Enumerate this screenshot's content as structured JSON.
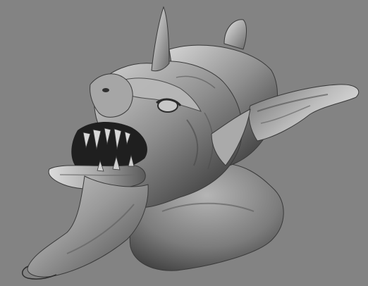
{
  "scene": {
    "subject": "sculpted-creature-head-bust",
    "render_style": "grayscale-clay-render",
    "colors": {
      "background": "#838383",
      "clay_light": "#d6d6d6",
      "clay_mid": "#8e8e8e",
      "clay_dark": "#2a2a2a",
      "shadow": "#1e1e1e"
    },
    "features": [
      "horn",
      "ear-left",
      "ear-right",
      "open-mouth",
      "teeth",
      "tongue",
      "eye",
      "brow",
      "neck-bust"
    ]
  }
}
